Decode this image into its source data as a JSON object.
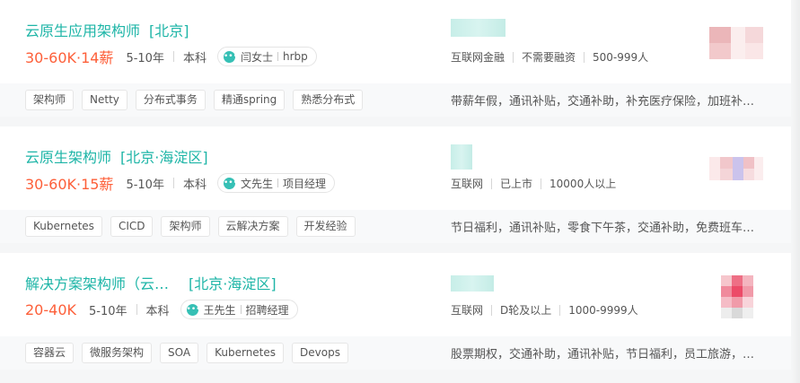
{
  "jobs": [
    {
      "title": "云原生应用架构师",
      "location": "[北京]",
      "salary": "30-60K·14薪",
      "experience": "5-10年",
      "education": "本科",
      "recruiter_name": "闫女士",
      "recruiter_role": "hrbp",
      "company_info": [
        "互联网金融",
        "不需要融资",
        "500-999人"
      ],
      "tags": [
        "架构师",
        "Netty",
        "分布式事务",
        "精通spring",
        "熟悉分布式"
      ],
      "welfare": "带薪年假，通讯补贴，交通补助，补充医疗保险，加班补…"
    },
    {
      "title": "云原生架构师",
      "location": "[北京·海淀区]",
      "salary": "30-60K·15薪",
      "experience": "5-10年",
      "education": "本科",
      "recruiter_name": "文先生",
      "recruiter_role": "项目经理",
      "company_info": [
        "互联网",
        "已上市",
        "10000人以上"
      ],
      "tags": [
        "Kubernetes",
        "CICD",
        "架构师",
        "云解决方案",
        "开发经验"
      ],
      "welfare": "节日福利，通讯补贴，零食下午茶，交通补助，免费班车…"
    },
    {
      "title": "解决方案架构师（云…",
      "location": "[北京·海淀区]",
      "salary": "20-40K",
      "experience": "5-10年",
      "education": "本科",
      "recruiter_name": "王先生",
      "recruiter_role": "招聘经理",
      "company_info": [
        "互联网",
        "D轮及以上",
        "1000-9999人"
      ],
      "tags": [
        "容器云",
        "微服务架构",
        "SOA",
        "Kubernetes",
        "Devops"
      ],
      "welfare": "股票期权，交通补助，通讯补贴，节日福利，员工旅游，…"
    }
  ],
  "icons": {
    "chat": "chat-bubble-icon"
  },
  "colors": {
    "title": "#1eb5a7",
    "salary": "#fd5f39",
    "chip_icon": "#36c0b5"
  }
}
